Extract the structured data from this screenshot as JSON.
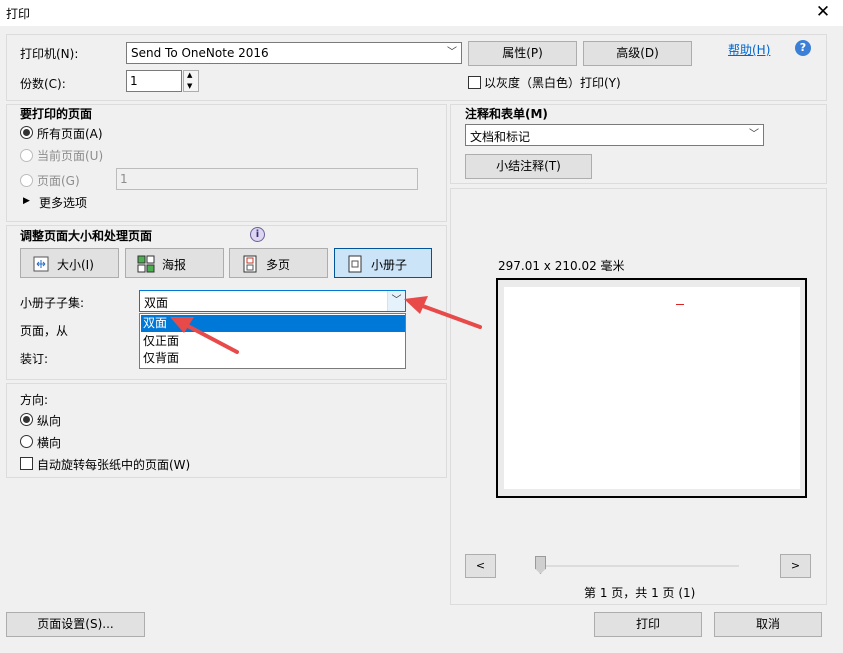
{
  "window": {
    "title": "打印"
  },
  "printer": {
    "label": "打印机(N):",
    "value": "Send To OneNote 2016",
    "properties_button": "属性(P)",
    "advanced_button": "高级(D)",
    "help_link": "帮助(H)"
  },
  "copies": {
    "label": "份数(C):",
    "value": "1"
  },
  "grayscale": {
    "label": "以灰度（黑白色）打印(Y)",
    "checked": false
  },
  "pages_to_print": {
    "heading": "要打印的页面",
    "all": "所有页面(A)",
    "current": "当前页面(U)",
    "pages": "页面(G)",
    "pages_value": "1",
    "more_options": "更多选项"
  },
  "page_sizing": {
    "heading": "调整页面大小和处理页面",
    "buttons": [
      "大小(I)",
      "海报",
      "多页",
      "小册子"
    ],
    "selected": "小册子"
  },
  "booklet": {
    "subset_label": "小册子子集:",
    "subset_value": "双面",
    "pages_from_label": "页面，从",
    "binding_label": "装订:",
    "options": [
      "双面",
      "仅正面",
      "仅背面"
    ]
  },
  "orientation": {
    "heading": "方向:",
    "portrait": "纵向",
    "landscape": "横向",
    "auto_rotate": "自动旋转每张纸中的页面(W)"
  },
  "comments_forms": {
    "heading": "注释和表单(M)",
    "value": "文档和标记",
    "summarize_button": "小结注释(T)"
  },
  "preview": {
    "dimensions": "297.01 x 210.02 毫米",
    "prev": "<",
    "next": ">",
    "page_status": "第 1 页，共 1 页 (1)"
  },
  "footer": {
    "page_setup": "页面设置(S)...",
    "print": "打印",
    "cancel": "取消"
  },
  "colors": {
    "accent": "#0078d7",
    "annotation_arrow": "#e84a4a"
  }
}
